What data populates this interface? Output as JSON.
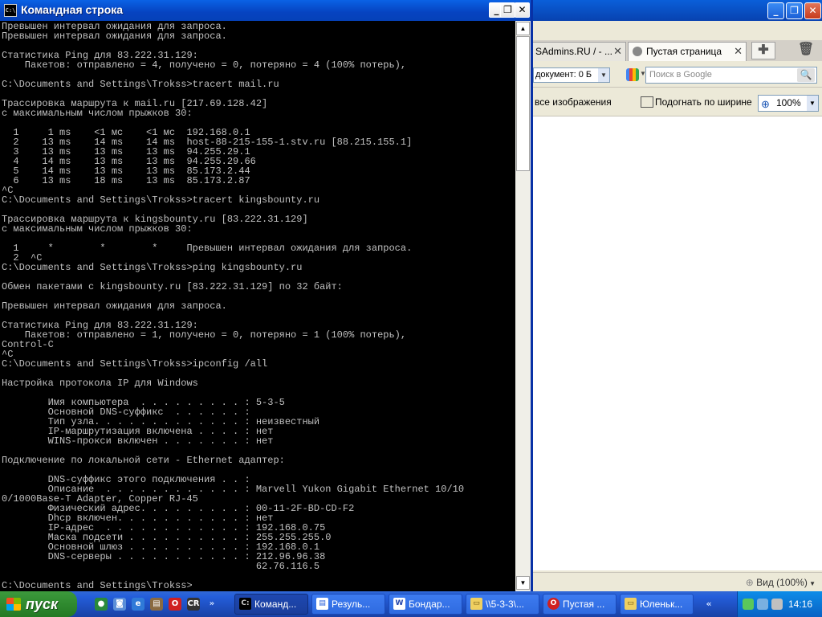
{
  "browser": {
    "tabs": [
      {
        "label": "SAdmins.RU / - ..."
      },
      {
        "label": "Пустая страница"
      }
    ],
    "doc_field": "документ:  0 Б",
    "search_placeholder": "Поиск в Google",
    "toolbar2": {
      "images": "все изображения",
      "fit_width": "Подогнать по ширине",
      "zoom": "100%"
    },
    "status_zoom": "Вид (100%)"
  },
  "cmd": {
    "title": "Командная строка",
    "icon_text": "C:\\",
    "console_lines": [
      "Превышен интервал ожидания для запроса.",
      "Превышен интервал ожидания для запроса.",
      "",
      "Статистика Ping для 83.222.31.129:",
      "    Пакетов: отправлено = 4, получено = 0, потеряно = 4 (100% потерь),",
      "",
      "C:\\Documents and Settings\\Trokss>tracert mail.ru",
      "",
      "Трассировка маршрута к mail.ru [217.69.128.42]",
      "с максимальным числом прыжков 30:",
      "",
      "  1     1 ms    <1 мс    <1 мс  192.168.0.1",
      "  2    13 ms    14 ms    14 ms  host-88-215-155-1.stv.ru [88.215.155.1]",
      "  3    13 ms    13 ms    13 ms  94.255.29.1",
      "  4    14 ms    13 ms    13 ms  94.255.29.66",
      "  5    14 ms    13 ms    13 ms  85.173.2.44",
      "  6    13 ms    18 ms    13 ms  85.173.2.87",
      "^C",
      "C:\\Documents and Settings\\Trokss>tracert kingsbounty.ru",
      "",
      "Трассировка маршрута к kingsbounty.ru [83.222.31.129]",
      "с максимальным числом прыжков 30:",
      "",
      "  1     *        *        *     Превышен интервал ожидания для запроса.",
      "  2  ^C",
      "C:\\Documents and Settings\\Trokss>ping kingsbounty.ru",
      "",
      "Обмен пакетами с kingsbounty.ru [83.222.31.129] по 32 байт:",
      "",
      "Превышен интервал ожидания для запроса.",
      "",
      "Статистика Ping для 83.222.31.129:",
      "    Пакетов: отправлено = 1, получено = 0, потеряно = 1 (100% потерь),",
      "Control-C",
      "^C",
      "C:\\Documents and Settings\\Trokss>ipconfig /all",
      "",
      "Настройка протокола IP для Windows",
      "",
      "        Имя компьютера  . . . . . . . . . : 5-3-5",
      "        Основной DNS-суффикс  . . . . . . :",
      "        Тип узла. . . . . . . . . . . . . : неизвестный",
      "        IP-маршрутизация включена . . . . : нет",
      "        WINS-прокси включен . . . . . . . : нет",
      "",
      "Подключение по локальной сети - Ethernet адаптер:",
      "",
      "        DNS-суффикс этого подключения . . :",
      "        Описание  . . . . . . . . . . . . : Marvell Yukon Gigabit Ethernet 10/10",
      "0/1000Base-T Adapter, Copper RJ-45",
      "        Физический адрес. . . . . . . . . : 00-11-2F-BD-CD-F2",
      "        Dhcp включен. . . . . . . . . . . : нет",
      "        IP-адрес  . . . . . . . . . . . . : 192.168.0.75",
      "        Маска подсети . . . . . . . . . . : 255.255.255.0",
      "        Основной шлюз . . . . . . . . . . : 192.168.0.1",
      "        DNS-серверы . . . . . . . . . . . : 212.96.96.38",
      "                                            62.76.116.5",
      "",
      "C:\\Documents and Settings\\Trokss>"
    ]
  },
  "taskbar": {
    "start_label": "пуск",
    "tasks": [
      {
        "label": "Команд...",
        "icon": "cmd-icon"
      },
      {
        "label": "Резуль...",
        "icon": "document-icon"
      },
      {
        "label": "Бондар...",
        "icon": "word-icon"
      },
      {
        "label": "\\\\5-3-3\\...",
        "icon": "folder-icon"
      },
      {
        "label": "Пустая ...",
        "icon": "opera-icon"
      },
      {
        "label": "Юленьк...",
        "icon": "folder-icon"
      }
    ],
    "clock": "14:16"
  }
}
